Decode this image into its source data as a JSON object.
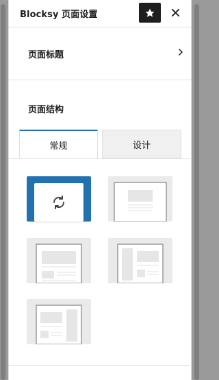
{
  "header": {
    "title": "Blocksy 页面设置",
    "star_icon": "star-icon",
    "close_icon": "close-icon"
  },
  "page_title_row": {
    "label": "页面标题",
    "chevron_icon": "chevron-right-icon"
  },
  "structure": {
    "title": "页面结构",
    "tabs": [
      {
        "label": "常规",
        "active": true
      },
      {
        "label": "设计",
        "active": false
      }
    ],
    "layouts": [
      {
        "name": "default-structure",
        "selected": true,
        "icon": "sync-icon"
      },
      {
        "name": "full-width",
        "selected": false
      },
      {
        "name": "contained",
        "selected": false
      },
      {
        "name": "left-sidebar",
        "selected": false
      },
      {
        "name": "right-sidebar",
        "selected": false
      }
    ]
  },
  "colors": {
    "accent": "#2271b1",
    "dark": "#1e1e1e"
  }
}
